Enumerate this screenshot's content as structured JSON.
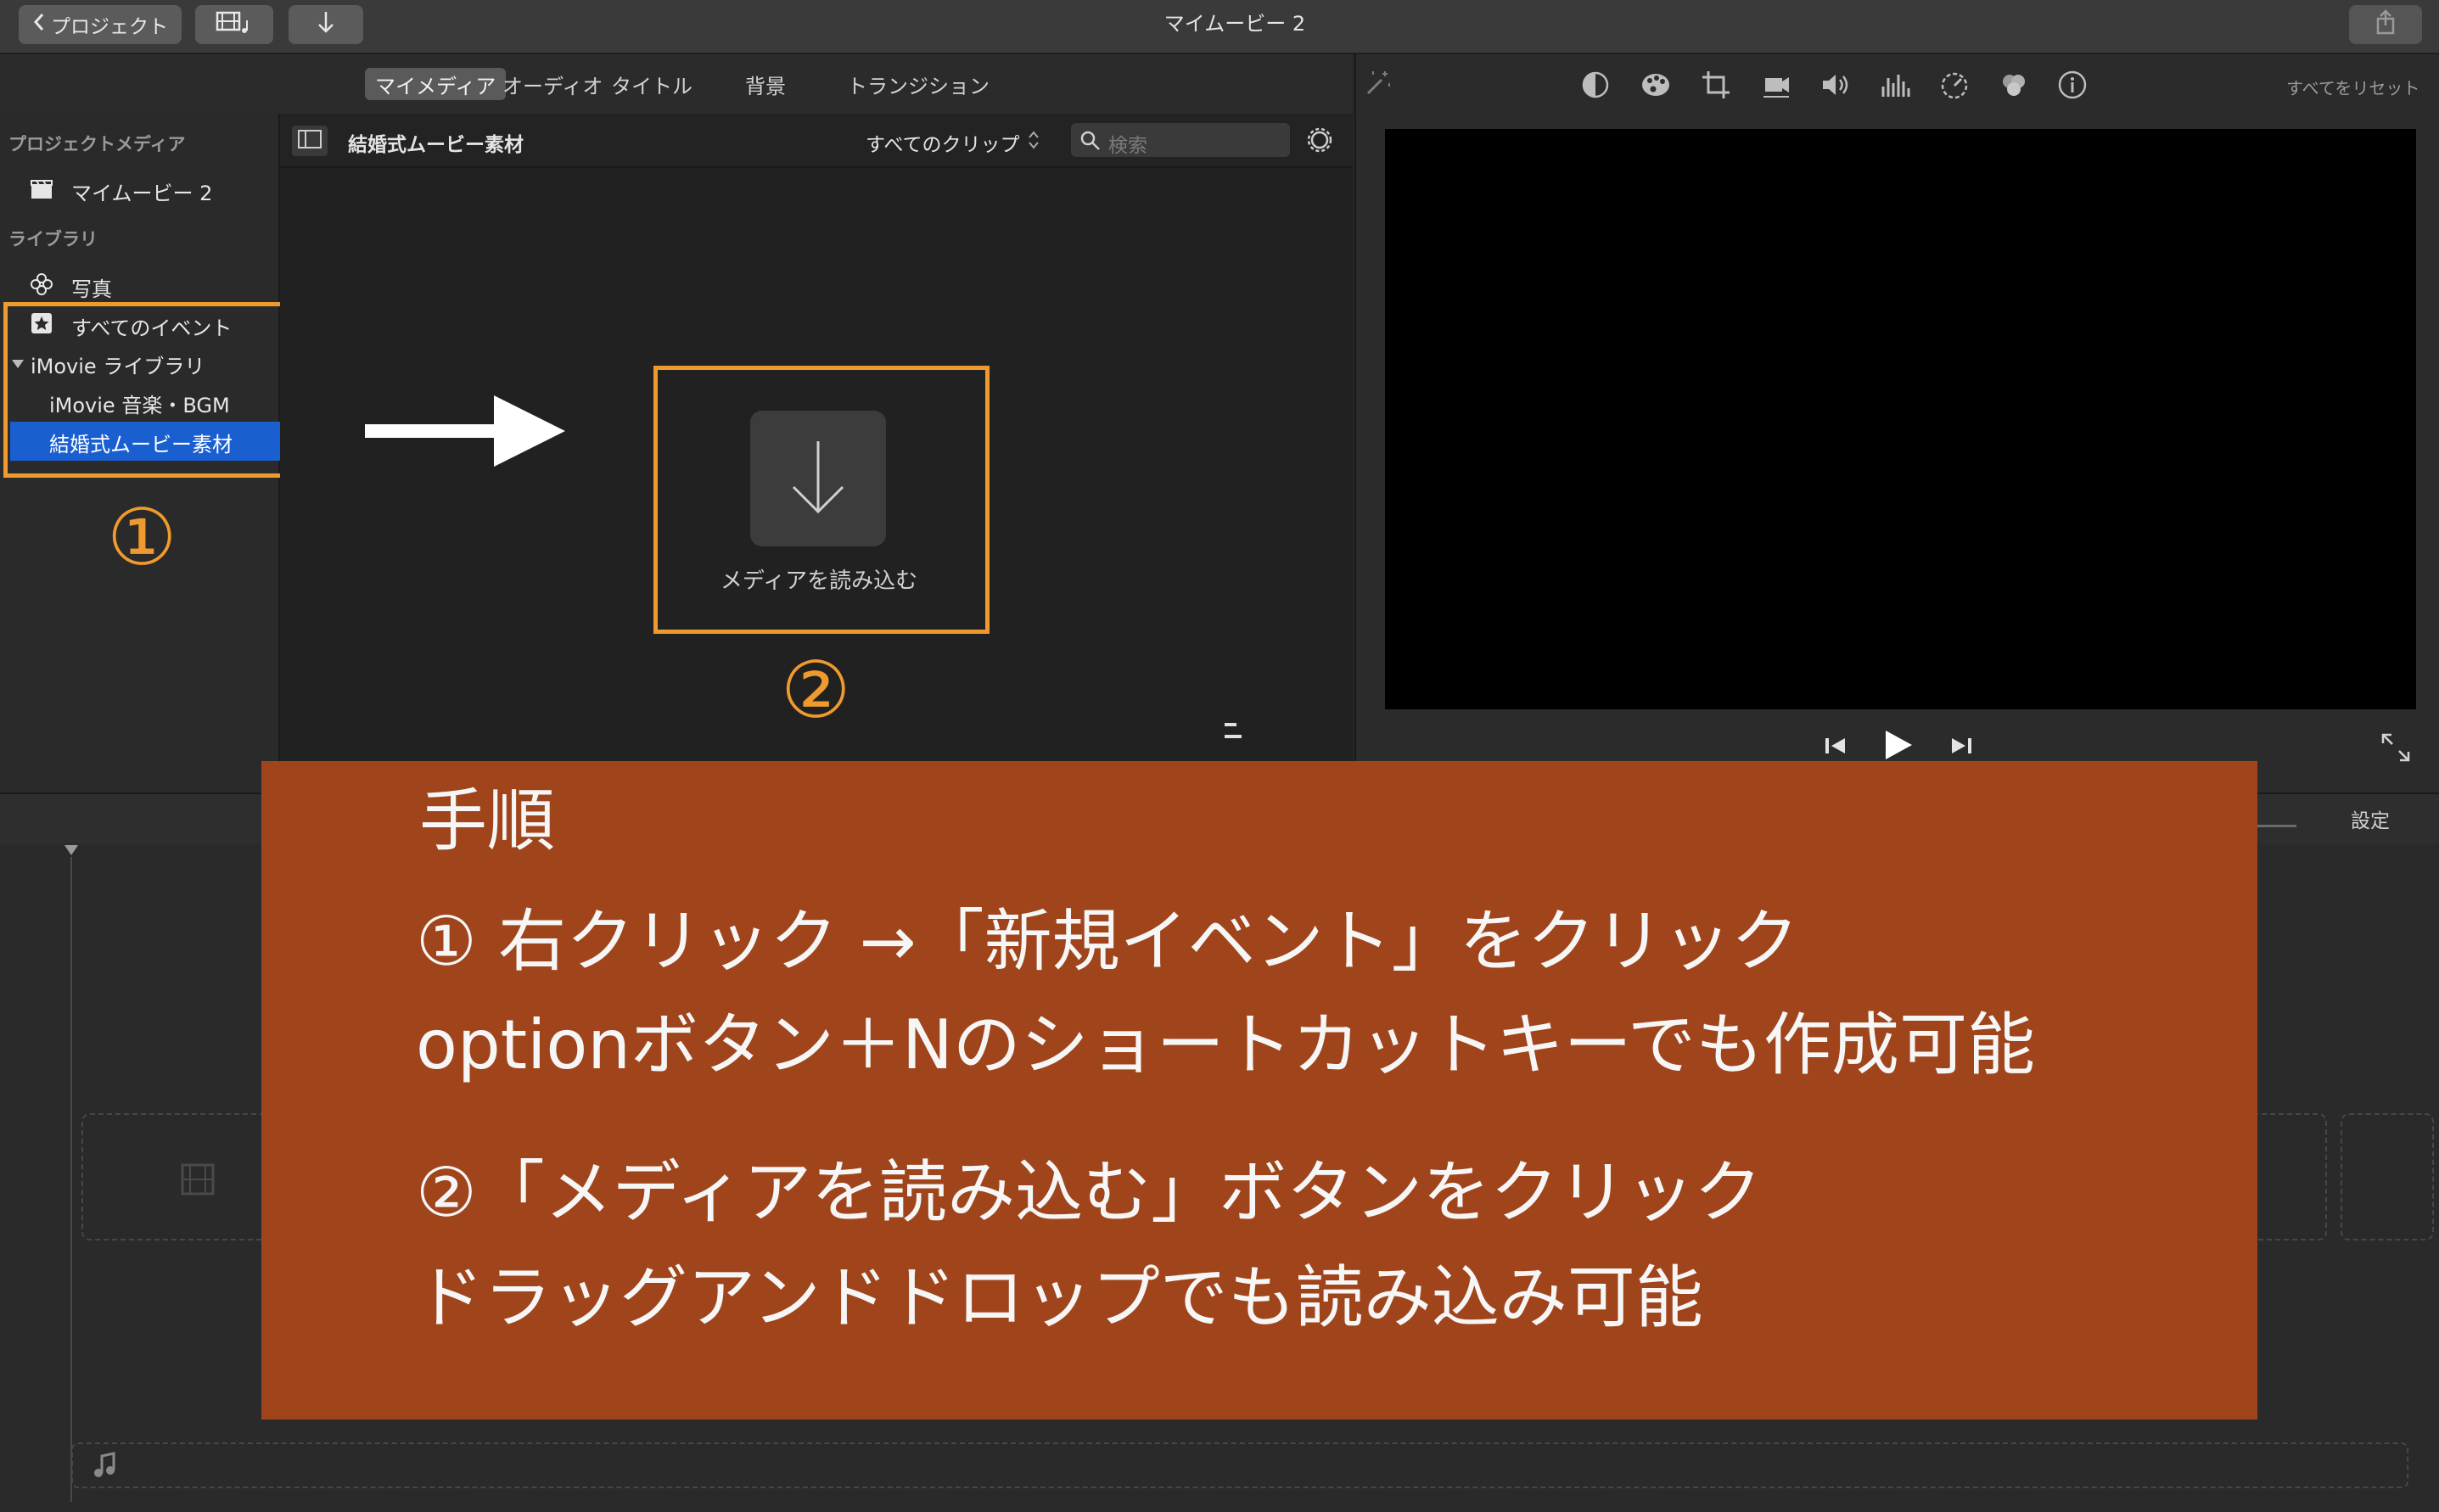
{
  "titlebar": {
    "back_label": "プロジェクト",
    "title": "マイムービー 2"
  },
  "tabs": [
    "マイメディア",
    "オーディオ",
    "タイトル",
    "背景",
    "トランジション"
  ],
  "sidebar": {
    "project_media_header": "プロジェクトメディア",
    "project_item": "マイムービー 2",
    "library_header": "ライブラリ",
    "photos_item": "写真",
    "all_events_item": "すべてのイベント",
    "imovie_library": "iMovie ライブラリ",
    "event_music": "iMovie 音楽・BGM",
    "event_wedding": "結婚式ムービー素材"
  },
  "browser": {
    "event_title": "結婚式ムービー素材",
    "filter_label": "すべてのクリップ",
    "search_placeholder": "検索",
    "import_label": "メディアを読み込む"
  },
  "viewer": {
    "reset_all": "すべてをリセット"
  },
  "timeline": {
    "settings_label": "設定"
  },
  "annotations": {
    "marker1": "①",
    "marker2": "②",
    "heading": "手順",
    "line1": "① 右クリック →「新規イベント」をクリック",
    "line2": "optionボタン＋Nのショートカットキーでも作成可能",
    "line3": "②「メディアを読み込む」ボタンをクリック",
    "line4": "ドラッグアンドドロップでも読み込み可能"
  },
  "colors": {
    "accent_orange": "#ef9a2e",
    "overlay_brown": "#a0451b",
    "selection_blue": "#1a5fd0"
  }
}
